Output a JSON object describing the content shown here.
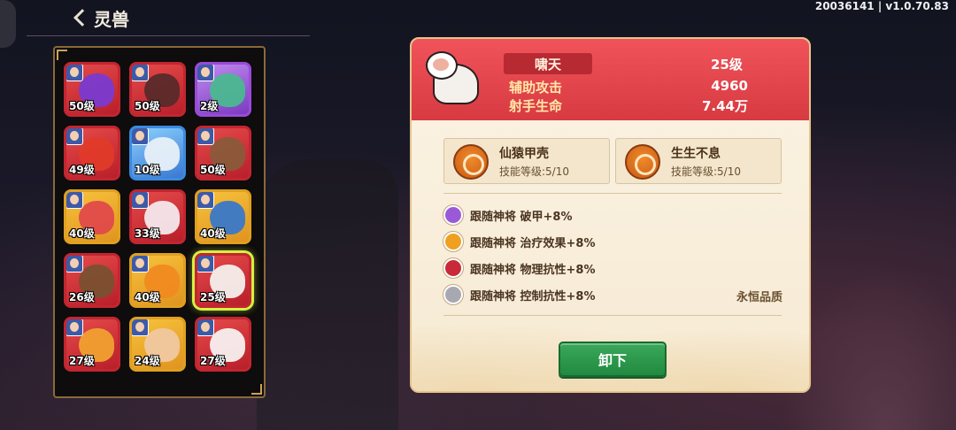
{
  "header": {
    "title": "灵兽",
    "version": "20036141 | v1.0.70.83"
  },
  "grid": {
    "items": [
      {
        "level": "50级",
        "frame": "red",
        "color": "#7a3ad0"
      },
      {
        "level": "50级",
        "frame": "red",
        "color": "#5a2a2a"
      },
      {
        "level": "2级",
        "frame": "purple",
        "color": "#4ab890"
      },
      {
        "level": "49级",
        "frame": "red",
        "color": "#e03a2a"
      },
      {
        "level": "10级",
        "frame": "blue",
        "color": "#e8f0f8"
      },
      {
        "level": "50级",
        "frame": "red",
        "color": "#8a5a3a"
      },
      {
        "level": "40级",
        "frame": "gold",
        "color": "#e04a4a"
      },
      {
        "level": "33级",
        "frame": "red",
        "color": "#f4e8ec"
      },
      {
        "level": "40级",
        "frame": "gold",
        "color": "#3a78c8"
      },
      {
        "level": "26级",
        "frame": "red",
        "color": "#7a5030"
      },
      {
        "level": "40级",
        "frame": "gold",
        "color": "#f08a20"
      },
      {
        "level": "25级",
        "frame": "red",
        "color": "#f4f0ec",
        "selected": true
      },
      {
        "level": "27级",
        "frame": "red",
        "color": "#f0a030"
      },
      {
        "level": "24级",
        "frame": "gold",
        "color": "#f0c8a0"
      },
      {
        "level": "27级",
        "frame": "red",
        "color": "#f8f0f0"
      }
    ]
  },
  "detail": {
    "name": "啸天",
    "level": "25级",
    "stats": [
      {
        "label": "辅助攻击",
        "value": "4960"
      },
      {
        "label": "射手生命",
        "value": "7.44万"
      }
    ],
    "skills": [
      {
        "name": "仙猿甲壳",
        "level": "技能等级:5/10",
        "icon": "ape-skill-icon"
      },
      {
        "name": "生生不息",
        "level": "技能等级:5/10",
        "icon": "flame-skill-icon"
      }
    ],
    "buffs": [
      {
        "text": "跟随神将 破甲+8%",
        "color": "#9a5ad8"
      },
      {
        "text": "跟随神将 治疗效果+8%",
        "color": "#f0a020"
      },
      {
        "text": "跟随神将 物理抗性+8%",
        "color": "#c82a3a"
      },
      {
        "text": "跟随神将 控制抗性+8%",
        "color": "#a8a8b0"
      }
    ],
    "quality": "永恒品质",
    "unequip_label": "卸下"
  }
}
